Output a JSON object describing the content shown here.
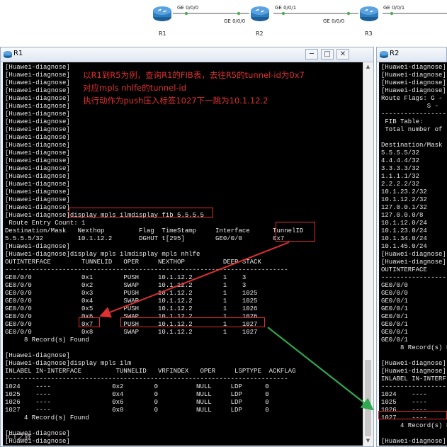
{
  "topology": {
    "routers": [
      "R1",
      "R2",
      "R3"
    ],
    "ports": {
      "r1_r2_left": "GE 0/0/0",
      "r1_r2_right": "GE 0/0/0",
      "r2_r3_left": "GE 0/0/1",
      "r2_r3_right": "GE 0/0/0",
      "r3_out": "GE 0/0/1"
    },
    "colors": {
      "link": "#555555",
      "port_dot": "#4caf50",
      "router": "#2f7fc0"
    }
  },
  "window_r1": {
    "title": "R1",
    "buttons": {
      "minimize": "─",
      "maximize": "□",
      "close": "✕"
    },
    "terminal_lines": [
      "[Huawei-diagnose]",
      "[Huawei-diagnose]",
      "[Huawei-diagnose]",
      "[Huawei-diagnose]",
      "[Huawei-diagnose]",
      "[Huawei-diagnose]",
      "[Huawei-diagnose]",
      "[Huawei-diagnose]",
      "[Huawei-diagnose]",
      "[Huawei-diagnose]",
      "[Huawei-diagnose]",
      "[Huawei-diagnose]",
      "[Huawei-diagnose]",
      "[Huawei-diagnose]",
      "[Huawei-diagnose]",
      "[Huawei-diagnose]",
      "[Huawei-diagnose]",
      "[Huawei-diagnose]",
      "[Huawei-diagnose]",
      "[Huawei-diagnose]display mpls ilmdisplay fib 5.5.5.5",
      " Route Entry Count: 1",
      "Destination/Mask   Nexthop         Flag  TimeStamp     Interface      TunnelID",
      "5.5.5.5/32         10.1.12.2       DGHUT t[295]        GE0/0/0        0x7",
      "[Huawei-diagnose]",
      "[Huawei-diagnose]display mpls ilmdisplay mpls nhlfe",
      "OUTINTERFACE        TUNNELID   OPER     NEXTHOP          DEEP STACK",
      "--------------------------------------------------------------------------",
      "GE0/0/0             0x1        PUSH     10.1.12.2        1    3",
      "GE0/0/0             0x2        SWAP     10.1.12.2        1    3",
      "GE0/0/0             0x3        PUSH     10.1.12.2        1    1025",
      "GE0/0/0             0x4        SWAP     10.1.12.2        1    1025",
      "GE0/0/0             0x5        PUSH     10.1.12.2        1    1026",
      "GE0/0/0             0x6        SWAP     10.1.12.2        1    1026",
      "GE0/0/0             0x7        PUSH     10.1.12.2        1    1027",
      "GE0/0/0             0x8        SWAP     10.1.12.2        1    1027",
      "     8 Record(s) Found",
      "",
      "[Huawei-diagnose]",
      "[Huawei-diagnose]display mpls ilm",
      "INLABEL IN-INTERFACE         TUNNELID   VRFINDEX   OPER     LSPTYPE  ACKFLAG",
      "--------------------------------------------------------------------------",
      "1024    ----                0x2        0          NULL     LDP      0",
      "1025    ----                0x4        0          NULL     LDP      0",
      "1026    ----                0x6        0          NULL     LDP      0",
      "1027    ----                0x8        0          NULL     LDP      0",
      "     4 Record(s) Found",
      "",
      "[Huawei-diagnose]",
      "[Huawei-diagnose]"
    ]
  },
  "window_r2": {
    "title": "R2",
    "terminal_lines": [
      "[Huawei-diagnose]",
      "[Huawei-diagnose]",
      "[Huawei-diagnose]",
      "[Huawei-diagnose]",
      "Route Flags: G -",
      "            S -",
      "-----------------",
      " FIB Table:",
      " Total number of",
      "",
      "Destination/Mask",
      "5.5.5.5/32",
      "4.4.4.4/32",
      "3.3.3.3/32",
      "1.1.1.1/32",
      "2.2.2.2/32",
      "10.1.23.2/32",
      "10.1.12.2/32",
      "127.0.0.1/32",
      "127.0.0.0/8",
      "10.1.12.0/24",
      "10.1.23.0/24",
      "10.1.34.0/24",
      "10.1.45.0/24",
      "[Huawei-diagnose]",
      "[Huawei-diagnose]",
      "OUTINTERFACE",
      "-----------------",
      "GE0/0/0",
      "GE0/0/0",
      "GE0/0/1",
      "GE0/0/1",
      "GE0/0/1",
      "GE0/0/1",
      "GE0/0/1",
      "GE0/0/1",
      "     8 Record(s) F",
      "",
      "[Huawei-diagnose]",
      "[Huawei-diagnose]",
      "INLABEL IN-INTERF",
      "-----------------",
      "1024    ----",
      "1025    ----",
      "1026    ----",
      "1027    ----",
      "     4 Record(s) F",
      "",
      "[Huawei-diagnose]",
      "[Huawei-diagnose]"
    ]
  },
  "annotation": {
    "lines": [
      "以R1到R5为例，查询R1的FIB表，去往R5的tunnel-id为0x7",
      "对应mpls nhlfe的tunnel-id",
      "执行动作为push压入标签1027下一跳为10.1.12.2"
    ],
    "color": "#e03030",
    "green_arrow_color": "#2fa84f"
  },
  "watermark": "ICT之旅"
}
